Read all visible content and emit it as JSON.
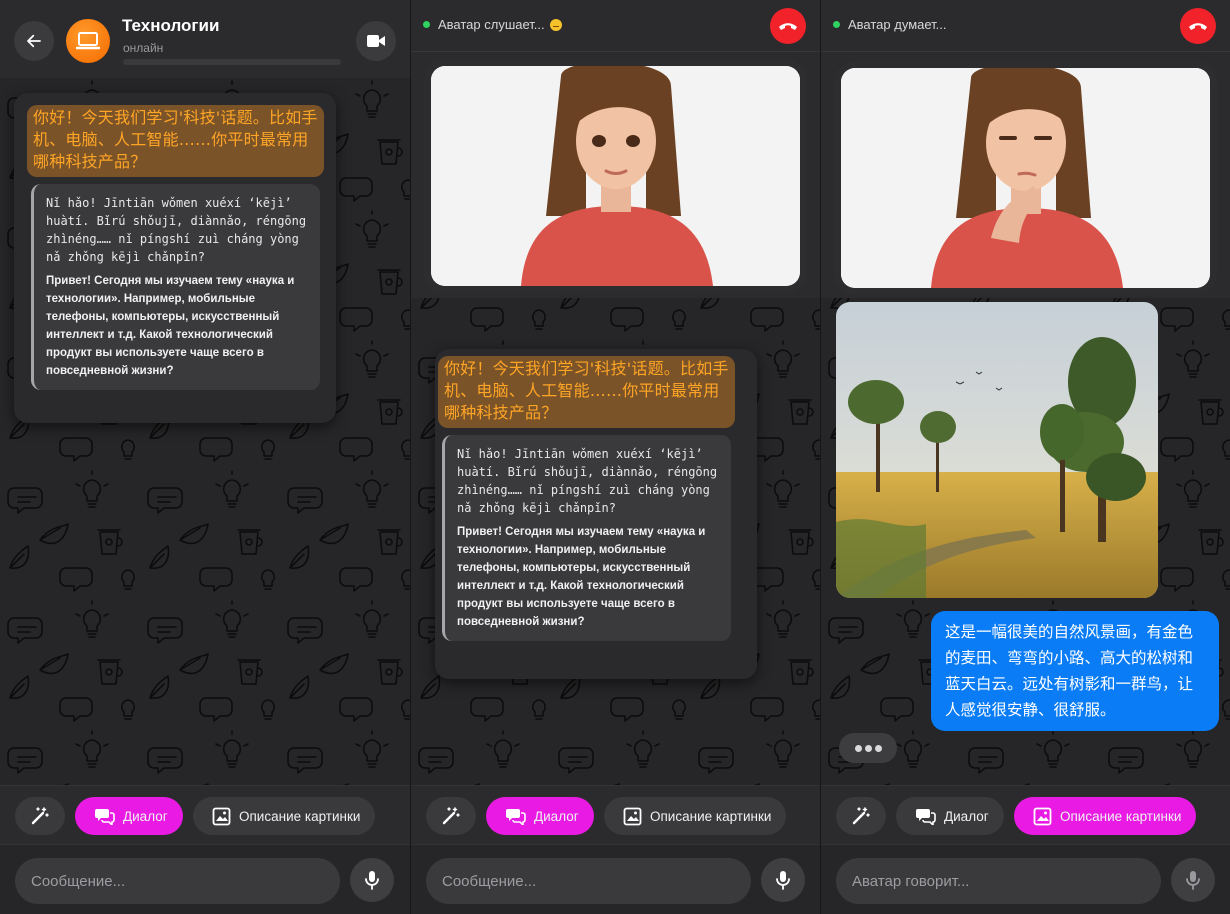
{
  "chat": {
    "title": "Технологии",
    "status": "онлайн"
  },
  "call_status": {
    "listening": "Аватар слушает...",
    "thinking": "Аватар думает..."
  },
  "message": {
    "chinese": "你好！今天我们学习'科技'话题。比如手机、电脑、人工智能……你平时最常用哪种科技产品？",
    "pinyin": "Nǐ hǎo! Jīntiān wǒmen xuéxí ‘kējì’ huàtí. Bǐrú shǒujī, diànnǎo, réngōng zhìnéng…… nǐ píngshí zuì cháng yòng nǎ zhǒng kējì chǎnpǐn?",
    "russian": "Привет! Сегодня мы изучаем тему «наука и технологии». Например, мобильные телефоны, компьютеры, искусственный интеллект и т.д. Какой технологический продукт вы используете чаще всего в повседневной жизни?"
  },
  "picture_description": "这是一幅很美的自然风景画，有金色的麦田、弯弯的小路、高大的松树和蓝天白云。远处有树影和一群鸟，让人感觉很安静、很舒服。",
  "modes": {
    "dialog": "Диалог",
    "picture": "Описание картинки"
  },
  "input": {
    "placeholder": "Сообщение...",
    "speaking_placeholder": "Аватар говорит..."
  },
  "icons": [
    "back-arrow-icon",
    "laptop-icon",
    "video-camera-icon",
    "hang-up-icon",
    "magic-wand-icon",
    "chat-bubbles-icon",
    "image-icon",
    "microphone-icon",
    "typing-dots-icon"
  ],
  "colors": {
    "accent": "#e81ae3",
    "hangup": "#f2222b",
    "user_bubble": "#0a7cf5",
    "chinese_text": "#ffa526",
    "online": "#2fd15f"
  }
}
